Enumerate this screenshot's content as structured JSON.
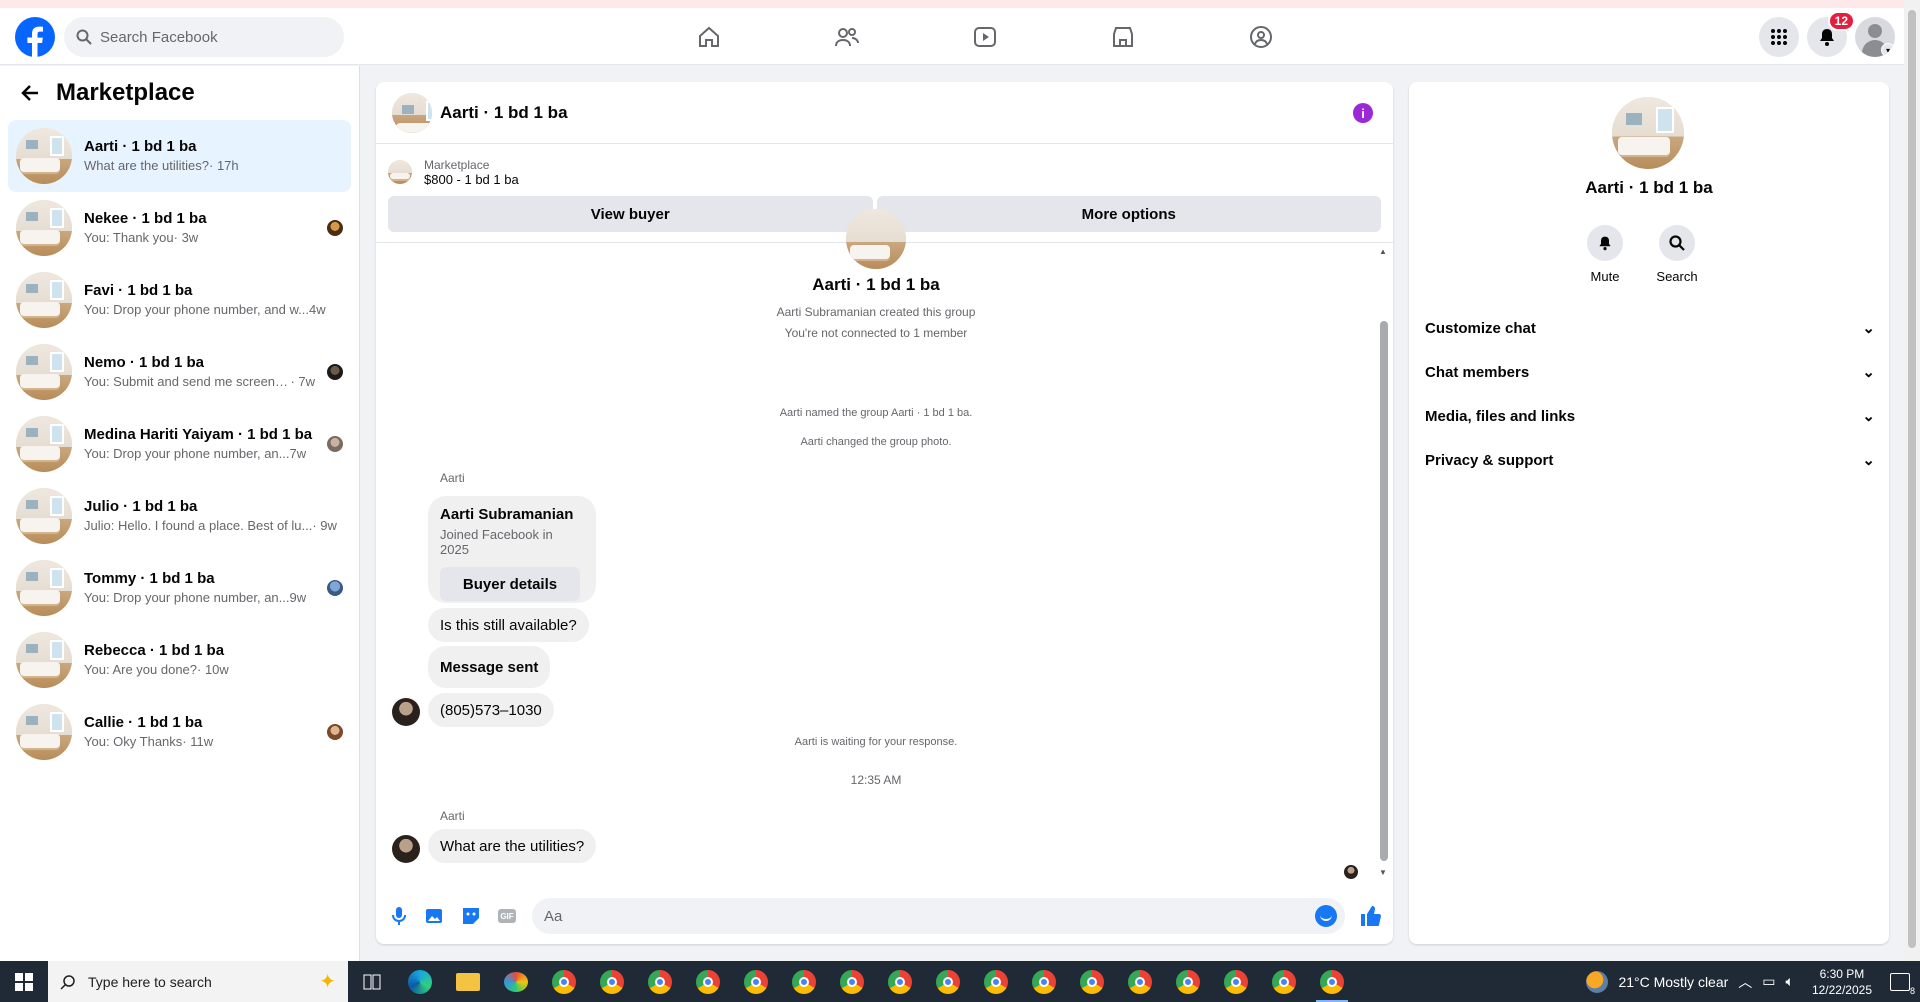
{
  "topnav": {
    "search_placeholder": "Search Facebook",
    "notifications_count": "12"
  },
  "sidebar": {
    "title": "Marketplace",
    "conversations": [
      {
        "name": "Aarti · 1 bd 1 ba",
        "preview": "What are the utilities?",
        "time": " · 17h",
        "active": true
      },
      {
        "name": "Nekee · 1 bd 1 ba",
        "preview": "You: Thank you",
        "time": " · 3w"
      },
      {
        "name": "Favi · 1 bd 1 ba",
        "preview": "You: Drop your phone number, and w...",
        "time": " 4w"
      },
      {
        "name": "Nemo · 1 bd 1 ba",
        "preview": "You: Submit and send me screen s...",
        "time": " · 7w"
      },
      {
        "name": "Medina Hariti Yaiyam · 1 bd 1 ba",
        "preview": "You: Drop your phone number, an...",
        "time": " 7w"
      },
      {
        "name": "Julio · 1 bd 1 ba",
        "preview": "Julio: Hello. I found a place. Best of lu...",
        "time": " · 9w"
      },
      {
        "name": "Tommy · 1 bd 1 ba",
        "preview": "You: Drop your phone number, an...",
        "time": " 9w"
      },
      {
        "name": "Rebecca · 1 bd 1 ba",
        "preview": "You: Are you done?",
        "time": " · 10w"
      },
      {
        "name": "Callie · 1 bd 1 ba",
        "preview": "You: Oky Thanks",
        "time": " · 11w"
      }
    ]
  },
  "chat": {
    "title": "Aarti · 1 bd 1 ba",
    "marketplace_label": "Marketplace",
    "listing": "$800 - 1 bd 1 ba",
    "view_buyer": "View buyer",
    "more_options": "More options",
    "group_title": "Aarti · 1 bd 1 ba",
    "created": "Aarti Subramanian created this group",
    "not_connected": "You're not connected to 1 member",
    "named": "Aarti named the group Aarti · 1 bd 1 ba.",
    "photo": "Aarti changed the group photo.",
    "sender1": "Aarti",
    "card_name": "Aarti Subramanian",
    "card_sub": "Joined Facebook in 2025",
    "card_button": "Buyer details",
    "msg_available": "Is this still available?",
    "msg_sent": "Message sent",
    "msg_phone": "(805)573–1030",
    "waiting": "Aarti is waiting for your response.",
    "timestamp": "12:35 AM",
    "sender2": "Aarti",
    "msg_utilities": "What are the utilities?",
    "composer_placeholder": "Aa"
  },
  "info_panel": {
    "name": "Aarti · 1 bd 1 ba",
    "mute": "Mute",
    "search": "Search",
    "sections": [
      "Customize chat",
      "Chat members",
      "Media, files and links",
      "Privacy & support"
    ]
  },
  "taskbar": {
    "search_placeholder": "Type here to search",
    "weather": "21°C  Mostly clear",
    "time": "6:30 PM",
    "date": "12/22/2025",
    "notif_count": "8"
  }
}
